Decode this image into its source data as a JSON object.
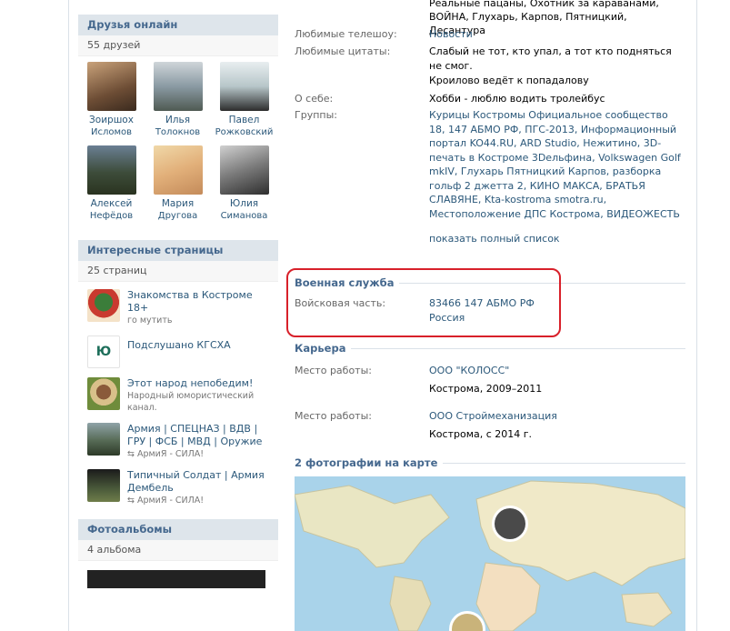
{
  "left": {
    "friends": {
      "title": "Друзья онлайн",
      "count": "55 друзей",
      "items": [
        {
          "first": "Зоиршох",
          "last": "Исломов"
        },
        {
          "first": "Илья",
          "last": "Толокнов"
        },
        {
          "first": "Павел",
          "last": "Рожковский"
        },
        {
          "first": "Алексей",
          "last": "Нефёдов"
        },
        {
          "first": "Мария",
          "last": "Другова"
        },
        {
          "first": "Юлия",
          "last": "Симанова"
        }
      ]
    },
    "pages": {
      "title": "Интересные страницы",
      "count": "25 страниц",
      "items": [
        {
          "name": "Знакомства в Костроме 18+",
          "sub": "го мутить"
        },
        {
          "name": "Подслушано КГСХА",
          "sub": ""
        },
        {
          "name": "Этот народ непобедим!",
          "sub": "Народный юмористический канал."
        },
        {
          "name": "Армия | СПЕЦНАЗ | ВДВ | ГРУ | ФСБ | МВД | Оружие",
          "sub": "АрмиЯ - СИЛА!"
        },
        {
          "name": "Типичный Солдат | Армия Дембель",
          "sub": "АрмиЯ - СИЛА!"
        }
      ]
    },
    "albums": {
      "title": "Фотоальбомы",
      "count": "4 альбома"
    }
  },
  "right": {
    "top_line": "Реальные пацаны, Охотник за караванами, ВОЙНА, Глухарь, Карпов, Пятницкий, Десантура",
    "tv": {
      "label": "Любимые телешоу:",
      "value": "Новости"
    },
    "quotes": {
      "label": "Любимые цитаты:",
      "value1": "Слабый не тот, кто упал, а тот кто подняться не смог.",
      "value2": "Кроилово ведёт к попадалову"
    },
    "about": {
      "label": "О себе:",
      "value": "Хобби - люблю водить тролейбус"
    },
    "groups": {
      "label": "Группы:",
      "value": "Курицы Костромы Официальное сообщество 18, 147 АБМО РФ, ПГС-2013, Информационный портал KO44.RU, ARD Studio, Нежитино, 3D-печать в Костроме 3Dельфина, Volkswagen Golf mkIV, Глухарь Пятницкий Карпов, разборка гольф 2 джетта 2, КИНО МАКСА, БРАТЬЯ СЛАВЯНЕ, Kta-kostroma smotra.ru, Местоположение ДПС Кострома, ВИДЕОЖЕСТЬ",
      "show_all": "показать полный список"
    },
    "military": {
      "title": "Военная служба",
      "label": "Войсковая часть:",
      "unit": "83466 147 АБМО РФ",
      "country": "Россия"
    },
    "career": {
      "title": "Карьера",
      "jobs": [
        {
          "label": "Место работы:",
          "company": "ООО \"КОЛОСС\"",
          "detail": "Кострома, 2009–2011"
        },
        {
          "label": "Место работы:",
          "company": "ООО Строймеханизация",
          "detail": "Кострома, с 2014 г."
        }
      ]
    },
    "photos_map": {
      "title": "2 фотографии на карте"
    }
  },
  "colors": {
    "link": "#2b587a",
    "header_bg": "#dee5eb",
    "header_text": "#45688e",
    "highlight": "#d8202a"
  }
}
